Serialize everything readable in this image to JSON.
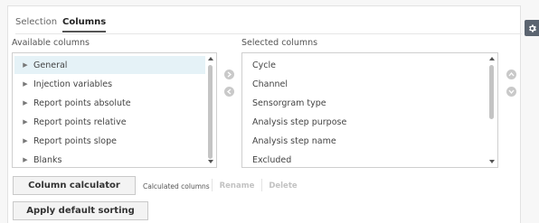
{
  "tabs": [
    {
      "label": "Selection",
      "active": false
    },
    {
      "label": "Columns",
      "active": true
    }
  ],
  "available": {
    "label": "Available columns",
    "items": [
      {
        "label": "General",
        "selected": true
      },
      {
        "label": "Injection variables",
        "selected": false
      },
      {
        "label": "Report points absolute",
        "selected": false
      },
      {
        "label": "Report points relative",
        "selected": false
      },
      {
        "label": "Report points slope",
        "selected": false
      },
      {
        "label": "Blanks",
        "selected": false
      }
    ]
  },
  "selected_cols": {
    "label": "Selected columns",
    "items": [
      "Cycle",
      "Channel",
      "Sensorgram type",
      "Analysis step purpose",
      "Analysis step name",
      "Excluded"
    ]
  },
  "buttons": {
    "column_calculator": "Column calculator",
    "calculated_columns": "Calculated columns",
    "rename": "Rename",
    "delete": "Delete",
    "apply_default_sorting": "Apply default sorting"
  },
  "icons": {
    "settings": "gear-icon",
    "expand": "caret-right-icon",
    "move_right": "move-right-icon",
    "move_left": "move-left-icon",
    "move_up": "move-up-icon",
    "move_down": "move-down-icon"
  },
  "colors": {
    "selected_row": "#e5f2f7",
    "gear_bg": "#5b6470",
    "disabled_text": "#c2c2c2"
  }
}
